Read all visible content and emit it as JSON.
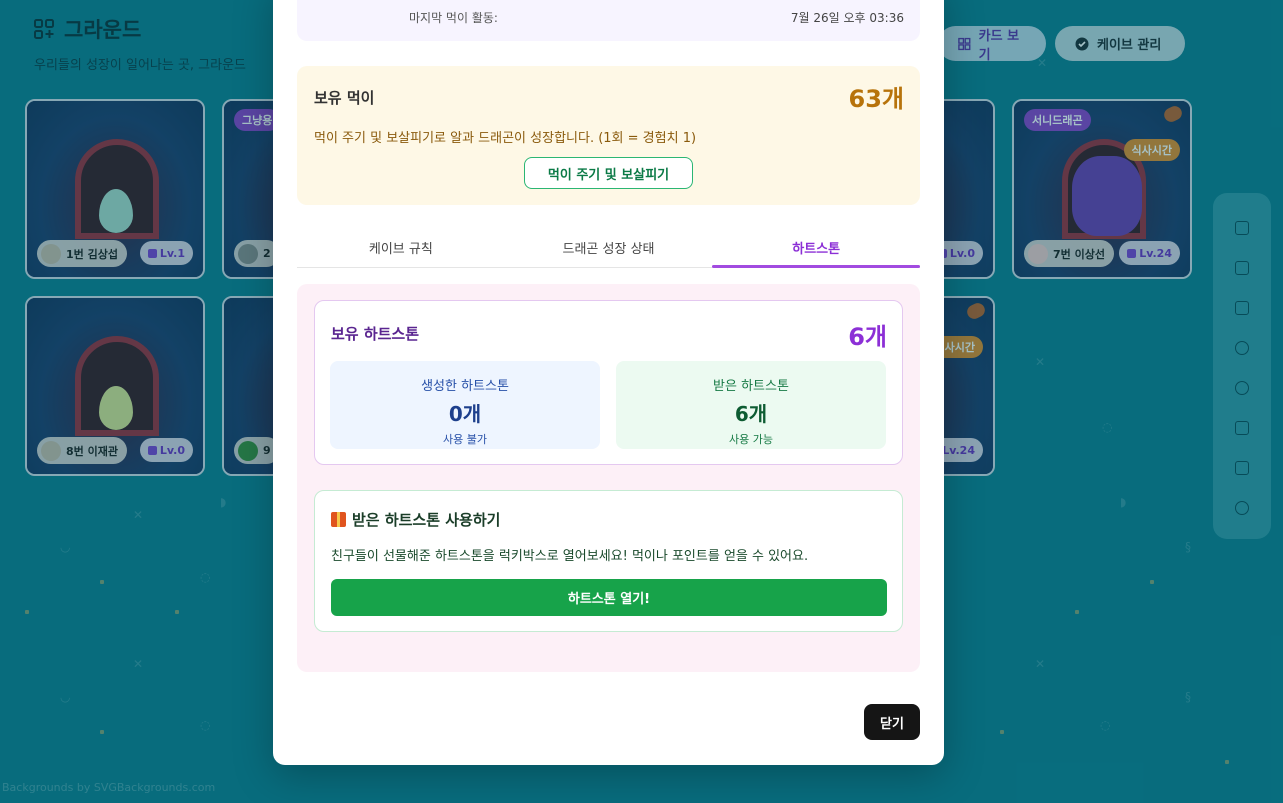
{
  "header": {
    "title": "그라운드",
    "subtitle": "우리들의 성장이 일어나는 곳, 그라운드",
    "card_view_label": "카드 보기",
    "cave_manage_label": "케이브 관리"
  },
  "cards": [
    {
      "name": "1번 김상섭",
      "level": "Lv.1",
      "type": "egg"
    },
    {
      "tag": "그냥용",
      "name": "2",
      "type": "egg"
    },
    {
      "name": "Lv.0",
      "type": "partial"
    },
    {
      "tag": "서니드래곤",
      "meal_tag": "식사시간",
      "name": "7번 이상선",
      "level": "Lv.24",
      "type": "dragon"
    },
    {
      "name": "8번 이재관",
      "level": "Lv.0",
      "type": "egg"
    },
    {
      "name": "9",
      "type": "egg"
    },
    {
      "meal_tag": "식사시간",
      "level": "Lv.24",
      "type": "partial"
    }
  ],
  "credit": "Backgrounds by SVGBackgrounds.com",
  "modal": {
    "last_activity_label": "마지막 먹이 활동:",
    "last_activity_value": "7월 26일 오후 03:36",
    "food": {
      "label": "보유 먹이",
      "count": "63개",
      "description": "먹이 주기 및 보살피기로 알과 드래곤이 성장합니다. (1회 = 경험치 1)",
      "button": "먹이 주기 및 보살피기"
    },
    "tabs": [
      "케이브 규칙",
      "드래곤 성장 상태",
      "하트스톤"
    ],
    "active_tab": 2,
    "heartstone": {
      "label": "보유 하트스톤",
      "count": "6개",
      "made": {
        "title": "생성한 하트스톤",
        "count": "0개",
        "note": "사용 불가"
      },
      "received": {
        "title": "받은 하트스톤",
        "count": "6개",
        "note": "사용 가능"
      }
    },
    "use": {
      "title": "받은 하트스톤 사용하기",
      "description": "친구들이 선물해준 하트스톤을 럭키박스로 열어보세요! 먹이나 포인트를 얻을 수 있어요.",
      "button": "하트스톤 열기!"
    },
    "close_label": "닫기"
  },
  "colors": {
    "background": "#0d7c8e",
    "accent_purple": "#8c2fd6",
    "food_amber": "#b7730b",
    "open_green": "#17a34a"
  }
}
